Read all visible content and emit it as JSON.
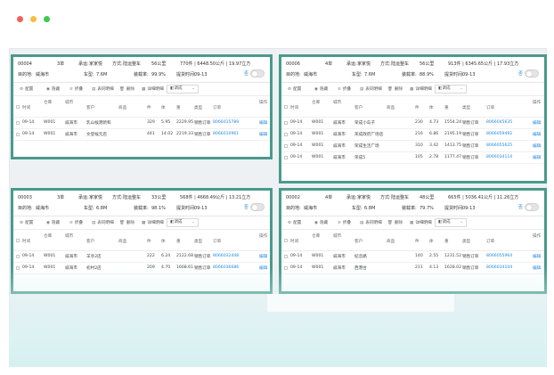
{
  "window": {
    "controls": [
      "close",
      "minimize",
      "maximize"
    ]
  },
  "panels": [
    {
      "id": "00004",
      "count": "3单",
      "carrier": "家家悦",
      "mode": "陆运整车",
      "distance": "56公里",
      "stats": "770件 | 6448.50公斤 | 19.97立方",
      "destination": "威海市",
      "vehicle_type": "7.6M",
      "load_rate": "99.9%",
      "pickup_time": "09-13",
      "toggle_label": "否",
      "labels": {
        "method": "方式:",
        "carrier": "承运:",
        "dest": "目的地:",
        "vtype": "车型:",
        "load": "装载率:",
        "pickup": "提货时间:"
      },
      "toolbar": [
        "配置",
        "隐藏",
        "折叠",
        "表同明细",
        "删除",
        "详细明细",
        "调成"
      ],
      "columns": [
        "时间",
        "仓库",
        "城市",
        "客户",
        "商品",
        "件",
        "体",
        "重",
        "类型",
        "订单",
        "操作"
      ],
      "rows": [
        {
          "time": "09-14",
          "wh": "W001",
          "city": "威海市",
          "cust": "乳山候港新和",
          "qty": "329",
          "vol": "5.95",
          "wt": "2229.95",
          "type": "销售订单",
          "order": "8066015789",
          "op": "编辑"
        },
        {
          "time": "09-14",
          "wh": "W001",
          "city": "威海市",
          "cust": "文登候元店",
          "qty": "441",
          "vol": "14.02",
          "wt": "2219.33",
          "type": "销售订单",
          "order": "8066010961",
          "op": "编辑"
        }
      ]
    },
    {
      "id": "00006",
      "count": "4单",
      "carrier": "家家悦",
      "mode": "陆运整车",
      "distance": "56公里",
      "stats": "913件 | 6345.65公斤 | 17.93立方",
      "destination": "威海市",
      "vehicle_type": "7.6M",
      "load_rate": "88.9%",
      "pickup_time": "09-13",
      "toggle_label": "否",
      "labels": {
        "method": "方式:",
        "carrier": "承运:",
        "dest": "目的地:",
        "vtype": "车型:",
        "load": "装载率:",
        "pickup": "提货时间:"
      },
      "toolbar": [
        "配置",
        "隐藏",
        "折叠",
        "表同明细",
        "删除",
        "详细明细",
        "调成"
      ],
      "columns": [
        "时间",
        "仓库",
        "城市",
        "客户",
        "商品",
        "件",
        "体",
        "重",
        "类型",
        "订单",
        "操作"
      ],
      "rows": [
        {
          "time": "09-14",
          "wh": "W001",
          "city": "威海市",
          "cust": "荣成小岛子",
          "qty": "230",
          "vol": "4.73",
          "wt": "1554.24",
          "type": "销售订单",
          "order": "8066045635",
          "op": "编辑"
        },
        {
          "time": "09-14",
          "wh": "W001",
          "city": "威海市",
          "cust": "荣成政府广场店",
          "qty": "216",
          "vol": "6.86",
          "wt": "2195.19",
          "type": "销售订单",
          "order": "8066059492",
          "op": "编辑"
        },
        {
          "time": "09-14",
          "wh": "W001",
          "city": "威海市",
          "cust": "荣成生活广场",
          "qty": "310",
          "vol": "3.42",
          "wt": "1413.75",
          "type": "销售订单",
          "order": "8066055625",
          "op": "编辑"
        },
        {
          "time": "09-14",
          "wh": "W001",
          "city": "威海市",
          "cust": "荣成5",
          "qty": "105",
          "vol": "2.78",
          "wt": "1177.47",
          "type": "销售订单",
          "order": "8066034114",
          "op": "编辑"
        }
      ]
    },
    {
      "id": "00003",
      "count": "3单",
      "carrier": "家家悦",
      "mode": "陆运整车",
      "distance": "33公里",
      "stats": "568件 | 4668.49公斤 | 13.21立方",
      "destination": "威海市",
      "vehicle_type": "6.8M",
      "load_rate": "98.1%",
      "pickup_time": "09-13",
      "toggle_label": "否",
      "labels": {
        "method": "方式:",
        "carrier": "承运:",
        "dest": "目的地:",
        "vtype": "车型:",
        "load": "装载率:",
        "pickup": "提货时间:"
      },
      "toolbar": [
        "配置",
        "隐藏",
        "折叠",
        "表同明细",
        "删除",
        "详细明细",
        "调成"
      ],
      "columns": [
        "时间",
        "仓库",
        "城市",
        "客户",
        "商品",
        "件",
        "体",
        "重",
        "类型",
        "订单",
        "操作"
      ],
      "rows": [
        {
          "time": "09-14",
          "wh": "W001",
          "city": "威海市",
          "cust": "羊亭2店",
          "qty": "222",
          "vol": "6.24",
          "wt": "2122.68",
          "type": "销售订单",
          "order": "8066032448",
          "op": "编辑"
        },
        {
          "time": "09-14",
          "wh": "W001",
          "city": "威海市",
          "cust": "初村2店",
          "qty": "209",
          "vol": "4.70",
          "wt": "1668.61",
          "type": "销售订单",
          "order": "8066036686",
          "op": "编辑"
        }
      ]
    },
    {
      "id": "00002",
      "count": "4单",
      "carrier": "家家悦",
      "mode": "陆运整车",
      "distance": "48公里",
      "stats": "665件 | 5036.41公斤 | 11.26立方",
      "destination": "威海市",
      "vehicle_type": "6.8M",
      "load_rate": "79.7%",
      "pickup_time": "09-13",
      "toggle_label": "否",
      "labels": {
        "method": "方式:",
        "carrier": "承运:",
        "dest": "目的地:",
        "vtype": "车型:",
        "load": "装载率:",
        "pickup": "提货时间:"
      },
      "toolbar": [
        "配置",
        "隐藏",
        "折叠",
        "表同明细",
        "删除",
        "详细明细",
        "调成"
      ],
      "columns": [
        "时间",
        "仓库",
        "城市",
        "客户",
        "商品",
        "件",
        "体",
        "重",
        "类型",
        "订单",
        "操作"
      ],
      "rows": [
        {
          "time": "09-14",
          "wh": "W001",
          "city": "威海市",
          "cust": "纪念路",
          "qty": "140",
          "vol": "2.55",
          "wt": "1231.52",
          "type": "销售订单",
          "order": "8066055964",
          "op": "编辑"
        },
        {
          "time": "09-14",
          "wh": "W001",
          "city": "威海市",
          "cust": "西港台",
          "qty": "211",
          "vol": "4.13",
          "wt": "1628.02",
          "type": "销售订单",
          "order": "8066034104",
          "op": "编辑"
        }
      ]
    }
  ],
  "colors": {
    "accent": "#4a9a8c",
    "link": "#1e88e5"
  }
}
